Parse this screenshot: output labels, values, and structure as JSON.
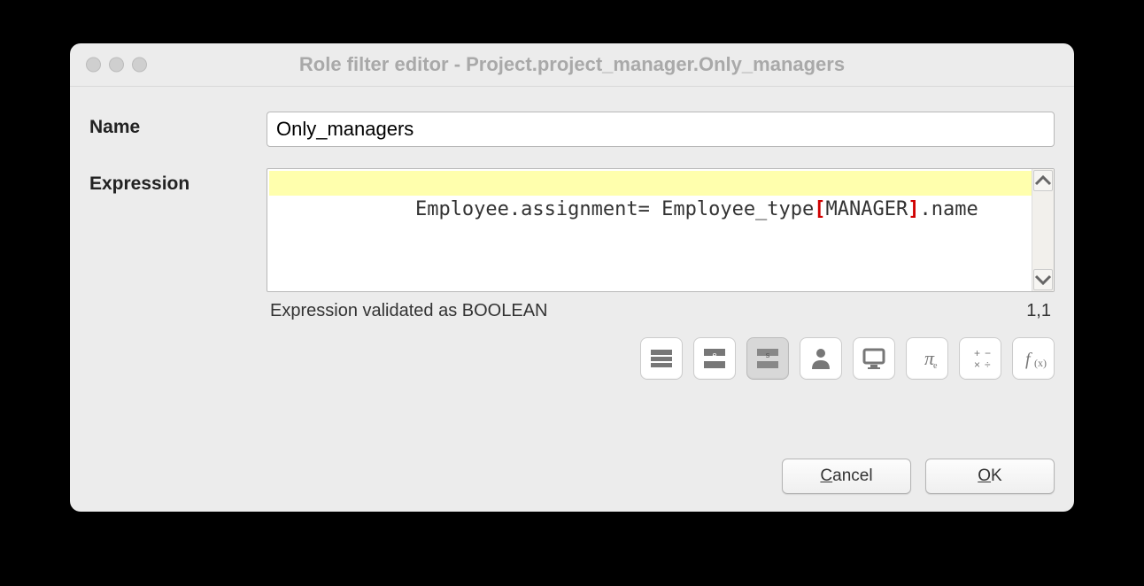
{
  "window": {
    "title": "Role filter editor - Project.project_manager.Only_managers"
  },
  "labels": {
    "name": "Name",
    "expression": "Expression"
  },
  "fields": {
    "name_value": "Only_managers",
    "expression": {
      "part1": "Employee.assignment= Employee_type",
      "lbracket": "[",
      "token": "MANAGER",
      "rbracket": "]",
      "part2": ".name"
    }
  },
  "status": {
    "message": "Expression validated as BOOLEAN",
    "position": "1,1"
  },
  "toolbar_icons": [
    "rows-icon",
    "entity-icon",
    "string-icon",
    "person-icon",
    "monitor-icon",
    "pi-icon",
    "operators-icon",
    "function-icon"
  ],
  "buttons": {
    "cancel_mnemonic": "C",
    "cancel_rest": "ancel",
    "ok_mnemonic": "O",
    "ok_rest": "K"
  }
}
